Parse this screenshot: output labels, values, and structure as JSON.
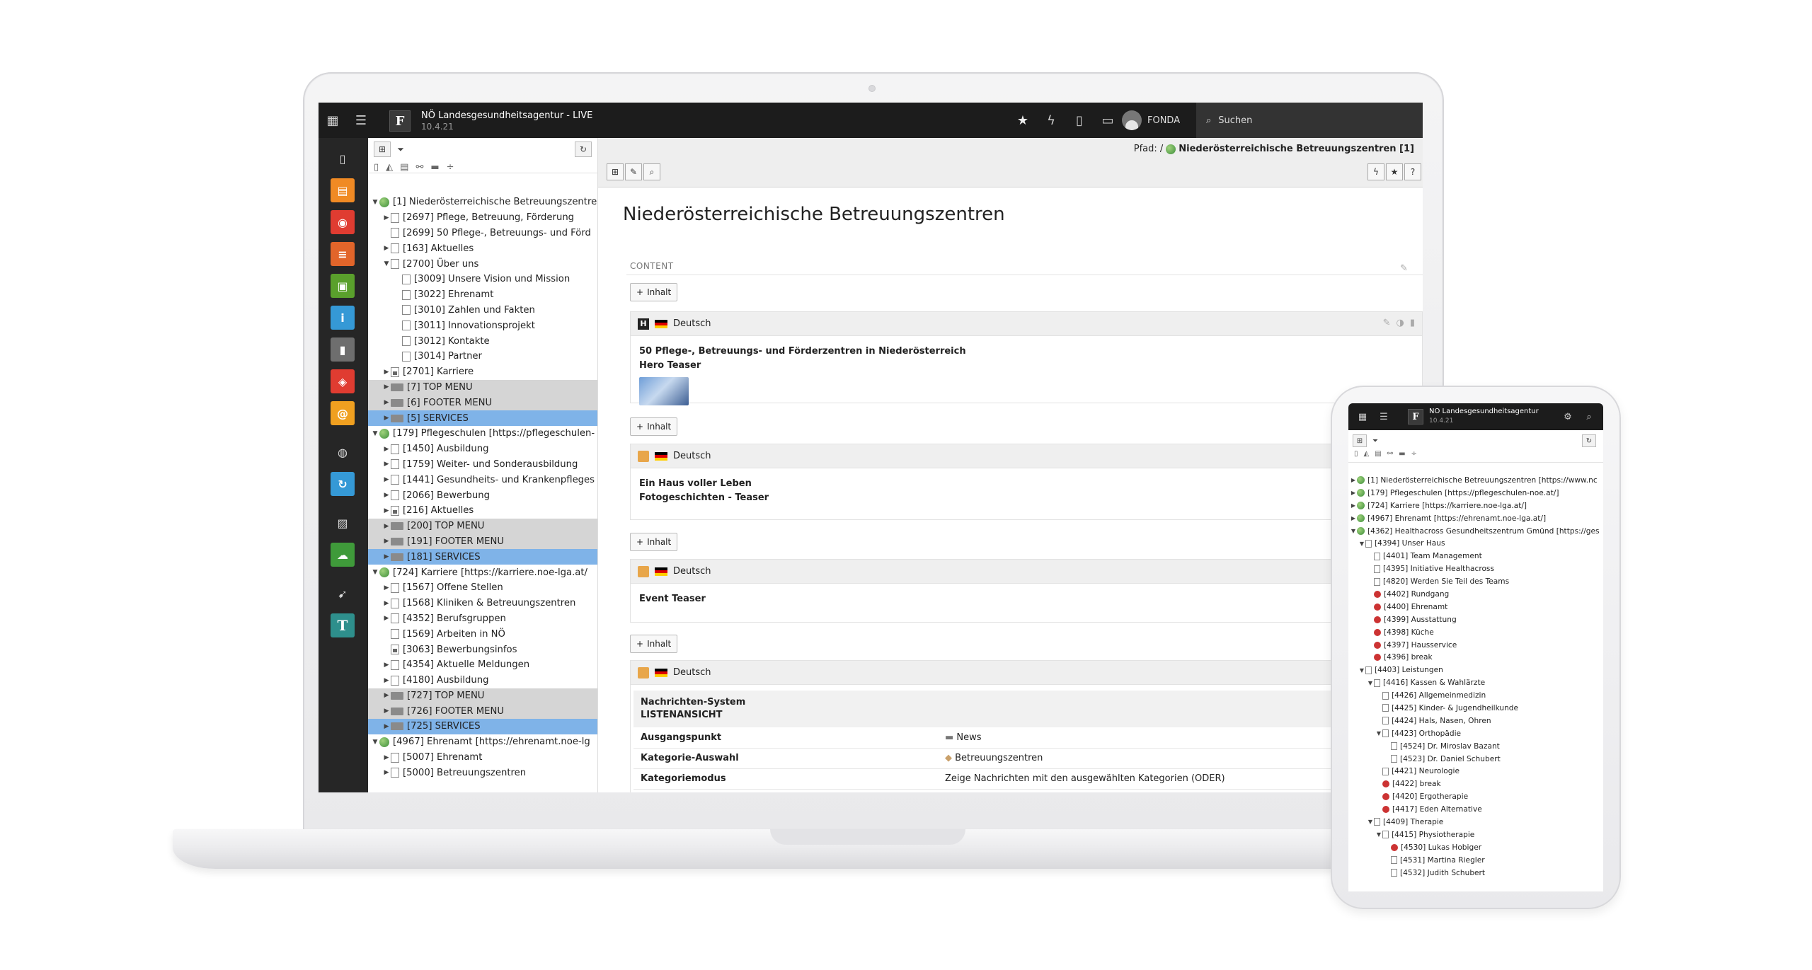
{
  "topbar": {
    "site_name": "NÖ Landesgesundheitsagentur - LIVE",
    "version": "10.4.21",
    "username": "FONDA",
    "search_label": "Suchen"
  },
  "breadcrumb": {
    "label": "Pfad: /",
    "current": "Niederösterreichische Betreuungszentren [1]"
  },
  "tree": [
    {
      "label": "[1] Niederösterreichische Betreuungszentre",
      "depth": 0,
      "toggle": "open",
      "icon": "globe",
      "hl": ""
    },
    {
      "label": "[2697] Pflege, Betreuung, Förderung",
      "depth": 1,
      "toggle": "closed",
      "icon": "page",
      "hl": ""
    },
    {
      "label": "[2699] 50 Pflege-, Betreuungs- und Förd",
      "depth": 1,
      "toggle": "",
      "icon": "page",
      "hl": ""
    },
    {
      "label": "[163] Aktuelles",
      "depth": 1,
      "toggle": "closed",
      "icon": "page",
      "hl": ""
    },
    {
      "label": "[2700] Über uns",
      "depth": 1,
      "toggle": "open",
      "icon": "page",
      "hl": ""
    },
    {
      "label": "[3009] Unsere Vision und Mission",
      "depth": 2,
      "toggle": "",
      "icon": "page",
      "hl": ""
    },
    {
      "label": "[3022] Ehrenamt",
      "depth": 2,
      "toggle": "",
      "icon": "page",
      "hl": ""
    },
    {
      "label": "[3010] Zahlen und Fakten",
      "depth": 2,
      "toggle": "",
      "icon": "page",
      "hl": ""
    },
    {
      "label": "[3011] Innovationsprojekt",
      "depth": 2,
      "toggle": "",
      "icon": "page",
      "hl": ""
    },
    {
      "label": "[3012] Kontakte",
      "depth": 2,
      "toggle": "",
      "icon": "page",
      "hl": ""
    },
    {
      "label": "[3014] Partner",
      "depth": 2,
      "toggle": "",
      "icon": "page",
      "hl": ""
    },
    {
      "label": "[2701] Karriere",
      "depth": 1,
      "toggle": "closed",
      "icon": "sub",
      "hl": ""
    },
    {
      "label": "[7] TOP MENU",
      "depth": 1,
      "toggle": "closed",
      "icon": "folder",
      "hl": "grey"
    },
    {
      "label": "[6] FOOTER MENU",
      "depth": 1,
      "toggle": "closed",
      "icon": "folder",
      "hl": "grey"
    },
    {
      "label": "[5] SERVICES",
      "depth": 1,
      "toggle": "closed",
      "icon": "folder",
      "hl": "blue"
    },
    {
      "label": "[179] Pflegeschulen [https://pflegeschulen-",
      "depth": 0,
      "toggle": "open",
      "icon": "globe",
      "hl": ""
    },
    {
      "label": "[1450] Ausbildung",
      "depth": 1,
      "toggle": "closed",
      "icon": "page",
      "hl": ""
    },
    {
      "label": "[1759] Weiter- und Sonderausbildung",
      "depth": 1,
      "toggle": "closed",
      "icon": "page",
      "hl": ""
    },
    {
      "label": "[1441] Gesundheits- und Krankenpfleges",
      "depth": 1,
      "toggle": "closed",
      "icon": "page",
      "hl": ""
    },
    {
      "label": "[2066] Bewerbung",
      "depth": 1,
      "toggle": "closed",
      "icon": "page",
      "hl": ""
    },
    {
      "label": "[216] Aktuelles",
      "depth": 1,
      "toggle": "closed",
      "icon": "sub",
      "hl": ""
    },
    {
      "label": "[200] TOP MENU",
      "depth": 1,
      "toggle": "closed",
      "icon": "folder",
      "hl": "grey"
    },
    {
      "label": "[191] FOOTER MENU",
      "depth": 1,
      "toggle": "closed",
      "icon": "folder",
      "hl": "grey"
    },
    {
      "label": "[181] SERVICES",
      "depth": 1,
      "toggle": "closed",
      "icon": "folder",
      "hl": "blue"
    },
    {
      "label": "[724] Karriere [https://karriere.noe-lga.at/",
      "depth": 0,
      "toggle": "open",
      "icon": "globe",
      "hl": ""
    },
    {
      "label": "[1567] Offene Stellen",
      "depth": 1,
      "toggle": "closed",
      "icon": "page",
      "hl": ""
    },
    {
      "label": "[1568] Kliniken & Betreuungszentren",
      "depth": 1,
      "toggle": "closed",
      "icon": "page",
      "hl": ""
    },
    {
      "label": "[4352] Berufsgruppen",
      "depth": 1,
      "toggle": "closed",
      "icon": "page",
      "hl": ""
    },
    {
      "label": "[1569] Arbeiten in NÖ",
      "depth": 1,
      "toggle": "",
      "icon": "page",
      "hl": ""
    },
    {
      "label": "[3063] Bewerbungsinfos",
      "depth": 1,
      "toggle": "",
      "icon": "sub",
      "hl": ""
    },
    {
      "label": "[4354] Aktuelle Meldungen",
      "depth": 1,
      "toggle": "closed",
      "icon": "page",
      "hl": ""
    },
    {
      "label": "[4180] Ausbildung",
      "depth": 1,
      "toggle": "closed",
      "icon": "page",
      "hl": ""
    },
    {
      "label": "[727] TOP MENU",
      "depth": 1,
      "toggle": "closed",
      "icon": "folder",
      "hl": "grey"
    },
    {
      "label": "[726] FOOTER MENU",
      "depth": 1,
      "toggle": "closed",
      "icon": "folder",
      "hl": "grey"
    },
    {
      "label": "[725] SERVICES",
      "depth": 1,
      "toggle": "closed",
      "icon": "folder",
      "hl": "blue"
    },
    {
      "label": "[4967] Ehrenamt [https://ehrenamt.noe-lg",
      "depth": 0,
      "toggle": "open",
      "icon": "globe",
      "hl": ""
    },
    {
      "label": "[5007] Ehrenamt",
      "depth": 1,
      "toggle": "closed",
      "icon": "page",
      "hl": ""
    },
    {
      "label": "[5000] Betreuungszentren",
      "depth": 1,
      "toggle": "closed",
      "icon": "page",
      "hl": ""
    }
  ],
  "main": {
    "title": "Niederösterreichische Betreuungszentren",
    "content_label": "CONTENT",
    "add_label": "Inhalt",
    "language": "Deutsch",
    "elements": [
      {
        "type_icon": "H",
        "line1": "50 Pflege-, Betreuungs- und Förderzentren in Niederösterreich",
        "line2": "Hero Teaser"
      },
      {
        "type_icon": "",
        "line1": "Ein Haus voller Leben",
        "line2": "Fotogeschichten - Teaser"
      },
      {
        "type_icon": "",
        "line1": "Event Teaser",
        "line2": ""
      }
    ],
    "news": {
      "title1": "Nachrichten-System",
      "title2": "LISTENANSICHT",
      "rows": [
        {
          "key": "Ausgangspunkt",
          "value": "News"
        },
        {
          "key": "Kategorie-Auswahl",
          "value": "Betreuungszentren"
        },
        {
          "key": "Kategoriemodus",
          "value": "Zeige Nachrichten mit den ausgewählten Kategorien (ODER)"
        }
      ]
    }
  },
  "phone": {
    "site_name": "NÖ Landesgesundheitsagentur",
    "version": "10.4.21",
    "tree": [
      {
        "label": "[1] Niederösterreichische Betreuungszentren [https://www.nc",
        "depth": 0,
        "toggle": "closed",
        "icon": "globe"
      },
      {
        "label": "[179] Pflegeschulen [https://pflegeschulen-noe.at/]",
        "depth": 0,
        "toggle": "closed",
        "icon": "globe"
      },
      {
        "label": "[724] Karriere [https://karriere.noe-lga.at/]",
        "depth": 0,
        "toggle": "closed",
        "icon": "globe"
      },
      {
        "label": "[4967] Ehrenamt [https://ehrenamt.noe-lga.at/]",
        "depth": 0,
        "toggle": "closed",
        "icon": "globe"
      },
      {
        "label": "[4362] Healthacross Gesundheitszentrum Gmünd [https://ges",
        "depth": 0,
        "toggle": "open",
        "icon": "globe"
      },
      {
        "label": "[4394] Unser Haus",
        "depth": 1,
        "toggle": "open",
        "icon": "page"
      },
      {
        "label": "[4401] Team Management",
        "depth": 2,
        "toggle": "",
        "icon": "page"
      },
      {
        "label": "[4395] Initiative Healthacross",
        "depth": 2,
        "toggle": "",
        "icon": "page"
      },
      {
        "label": "[4820] Werden Sie Teil des Teams",
        "depth": 2,
        "toggle": "",
        "icon": "page"
      },
      {
        "label": "[4402] Rundgang",
        "depth": 2,
        "toggle": "",
        "icon": "red"
      },
      {
        "label": "[4400] Ehrenamt",
        "depth": 2,
        "toggle": "",
        "icon": "red"
      },
      {
        "label": "[4399] Ausstattung",
        "depth": 2,
        "toggle": "",
        "icon": "red"
      },
      {
        "label": "[4398] Küche",
        "depth": 2,
        "toggle": "",
        "icon": "red"
      },
      {
        "label": "[4397] Hausservice",
        "depth": 2,
        "toggle": "",
        "icon": "red"
      },
      {
        "label": "[4396] break",
        "depth": 2,
        "toggle": "",
        "icon": "red"
      },
      {
        "label": "[4403] Leistungen",
        "depth": 1,
        "toggle": "open",
        "icon": "page"
      },
      {
        "label": "[4416] Kassen & Wahlärzte",
        "depth": 2,
        "toggle": "open",
        "icon": "page"
      },
      {
        "label": "[4426] Allgemeinmedizin",
        "depth": 3,
        "toggle": "",
        "icon": "page"
      },
      {
        "label": "[4425] Kinder- & Jugendheilkunde",
        "depth": 3,
        "toggle": "",
        "icon": "page"
      },
      {
        "label": "[4424] Hals, Nasen, Ohren",
        "depth": 3,
        "toggle": "",
        "icon": "page"
      },
      {
        "label": "[4423] Orthopädie",
        "depth": 3,
        "toggle": "open",
        "icon": "page"
      },
      {
        "label": "[4524] Dr. Miroslav Bazant",
        "depth": 4,
        "toggle": "",
        "icon": "page"
      },
      {
        "label": "[4523] Dr. Daniel Schubert",
        "depth": 4,
        "toggle": "",
        "icon": "page"
      },
      {
        "label": "[4421] Neurologie",
        "depth": 3,
        "toggle": "",
        "icon": "page"
      },
      {
        "label": "[4422] break",
        "depth": 3,
        "toggle": "",
        "icon": "red"
      },
      {
        "label": "[4420] Ergotherapie",
        "depth": 3,
        "toggle": "",
        "icon": "red"
      },
      {
        "label": "[4417] Eden Alternative",
        "depth": 3,
        "toggle": "",
        "icon": "red"
      },
      {
        "label": "[4409] Therapie",
        "depth": 2,
        "toggle": "open",
        "icon": "page"
      },
      {
        "label": "[4415] Physiotherapie",
        "depth": 3,
        "toggle": "open",
        "icon": "page"
      },
      {
        "label": "[4530] Lukas Hobiger",
        "depth": 4,
        "toggle": "",
        "icon": "red"
      },
      {
        "label": "[4531] Martina Riegler",
        "depth": 4,
        "toggle": "",
        "icon": "page"
      },
      {
        "label": "[4532] Judith Schubert",
        "depth": 4,
        "toggle": "",
        "icon": "page"
      }
    ]
  }
}
